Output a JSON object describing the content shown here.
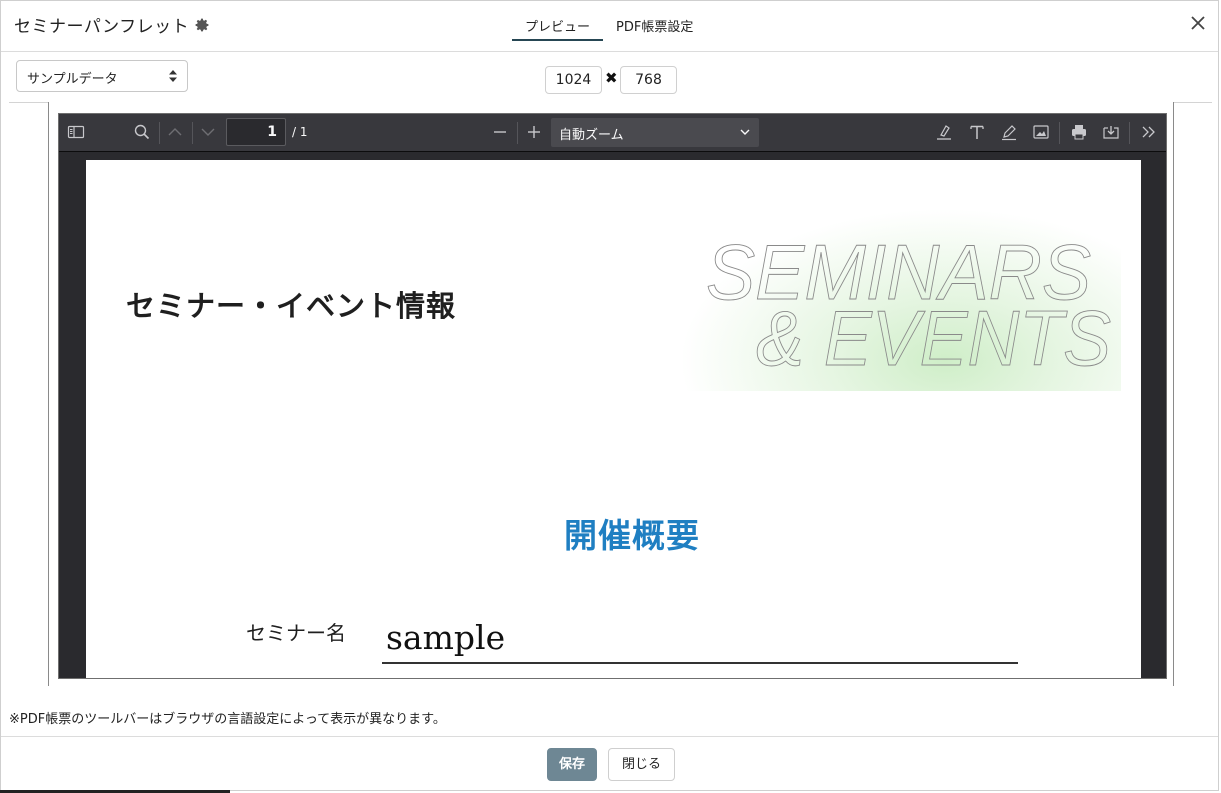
{
  "header": {
    "title": "セミナーパンフレット",
    "tabs": [
      {
        "label": "プレビュー",
        "active": true
      },
      {
        "label": "PDF帳票設定",
        "active": false
      }
    ]
  },
  "controls": {
    "data_select": "サンプルデータ",
    "width": "1024",
    "height": "768",
    "times_symbol": "✖"
  },
  "viewer": {
    "page_number": "1",
    "page_total": "/ 1",
    "zoom": "自動ズーム"
  },
  "pdf_page": {
    "title": "セミナー・イベント情報",
    "hero_line1": "SEMINARS",
    "hero_line2": "& EVENTS",
    "section_title": "開催概要",
    "field_label": "セミナー名",
    "field_value": "sample"
  },
  "footer": {
    "note": "※PDF帳票のツールバーはブラウザの言語設定によって表示が異なります。",
    "save_label": "保存",
    "close_label": "閉じる"
  },
  "colors": {
    "accent_dark": "#264653",
    "save_button": "#6e8794",
    "section_blue": "#1f7fc2",
    "viewer_toolbar": "#38383d"
  }
}
